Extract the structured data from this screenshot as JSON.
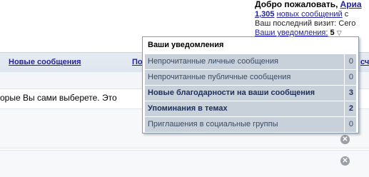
{
  "header": {
    "welcome_prefix": "Добро пожаловать,",
    "username": "Ариа",
    "new_posts_count": "1,305",
    "new_posts_text": "новых сообщений",
    "new_posts_suffix": "с",
    "last_visit": "Ваш последний визит: Сего",
    "notifications_link": "Ваши уведомления:",
    "notifications_count": "5"
  },
  "navbar": {
    "new_posts": "Новые сообщения",
    "partial_left": "По",
    "partial_right": "сч"
  },
  "notice": {
    "text": "орые Вы сами выберете. Это"
  },
  "popup": {
    "title": "Ваши уведомления",
    "items": [
      {
        "label": "Непрочитанные личные сообщения",
        "count": "0"
      },
      {
        "label": "Непрочитанные публичные сообщения",
        "count": "0"
      },
      {
        "label": "Новые благодарности на ваши сообщения",
        "count": "3"
      },
      {
        "label": "Упоминания в темах",
        "count": "2"
      },
      {
        "label": "Приглашения в социальные группы",
        "count": "0"
      }
    ]
  },
  "dismiss": {
    "symbol": "✕"
  }
}
